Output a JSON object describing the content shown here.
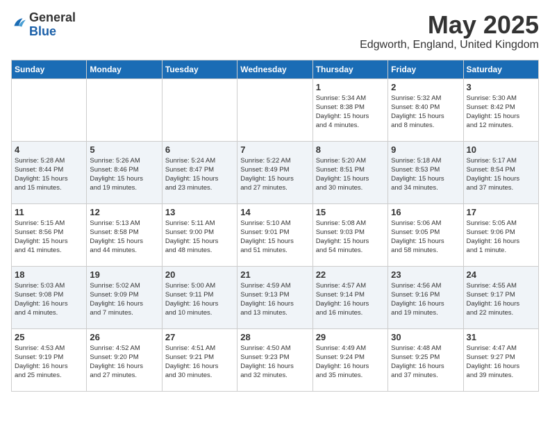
{
  "header": {
    "logo": {
      "general": "General",
      "blue": "Blue"
    },
    "title": "May 2025",
    "subtitle": "Edgworth, England, United Kingdom"
  },
  "days_of_week": [
    "Sunday",
    "Monday",
    "Tuesday",
    "Wednesday",
    "Thursday",
    "Friday",
    "Saturday"
  ],
  "weeks": [
    [
      {
        "day": "",
        "info": ""
      },
      {
        "day": "",
        "info": ""
      },
      {
        "day": "",
        "info": ""
      },
      {
        "day": "",
        "info": ""
      },
      {
        "day": "1",
        "info": "Sunrise: 5:34 AM\nSunset: 8:38 PM\nDaylight: 15 hours\nand 4 minutes."
      },
      {
        "day": "2",
        "info": "Sunrise: 5:32 AM\nSunset: 8:40 PM\nDaylight: 15 hours\nand 8 minutes."
      },
      {
        "day": "3",
        "info": "Sunrise: 5:30 AM\nSunset: 8:42 PM\nDaylight: 15 hours\nand 12 minutes."
      }
    ],
    [
      {
        "day": "4",
        "info": "Sunrise: 5:28 AM\nSunset: 8:44 PM\nDaylight: 15 hours\nand 15 minutes."
      },
      {
        "day": "5",
        "info": "Sunrise: 5:26 AM\nSunset: 8:46 PM\nDaylight: 15 hours\nand 19 minutes."
      },
      {
        "day": "6",
        "info": "Sunrise: 5:24 AM\nSunset: 8:47 PM\nDaylight: 15 hours\nand 23 minutes."
      },
      {
        "day": "7",
        "info": "Sunrise: 5:22 AM\nSunset: 8:49 PM\nDaylight: 15 hours\nand 27 minutes."
      },
      {
        "day": "8",
        "info": "Sunrise: 5:20 AM\nSunset: 8:51 PM\nDaylight: 15 hours\nand 30 minutes."
      },
      {
        "day": "9",
        "info": "Sunrise: 5:18 AM\nSunset: 8:53 PM\nDaylight: 15 hours\nand 34 minutes."
      },
      {
        "day": "10",
        "info": "Sunrise: 5:17 AM\nSunset: 8:54 PM\nDaylight: 15 hours\nand 37 minutes."
      }
    ],
    [
      {
        "day": "11",
        "info": "Sunrise: 5:15 AM\nSunset: 8:56 PM\nDaylight: 15 hours\nand 41 minutes."
      },
      {
        "day": "12",
        "info": "Sunrise: 5:13 AM\nSunset: 8:58 PM\nDaylight: 15 hours\nand 44 minutes."
      },
      {
        "day": "13",
        "info": "Sunrise: 5:11 AM\nSunset: 9:00 PM\nDaylight: 15 hours\nand 48 minutes."
      },
      {
        "day": "14",
        "info": "Sunrise: 5:10 AM\nSunset: 9:01 PM\nDaylight: 15 hours\nand 51 minutes."
      },
      {
        "day": "15",
        "info": "Sunrise: 5:08 AM\nSunset: 9:03 PM\nDaylight: 15 hours\nand 54 minutes."
      },
      {
        "day": "16",
        "info": "Sunrise: 5:06 AM\nSunset: 9:05 PM\nDaylight: 15 hours\nand 58 minutes."
      },
      {
        "day": "17",
        "info": "Sunrise: 5:05 AM\nSunset: 9:06 PM\nDaylight: 16 hours\nand 1 minute."
      }
    ],
    [
      {
        "day": "18",
        "info": "Sunrise: 5:03 AM\nSunset: 9:08 PM\nDaylight: 16 hours\nand 4 minutes."
      },
      {
        "day": "19",
        "info": "Sunrise: 5:02 AM\nSunset: 9:09 PM\nDaylight: 16 hours\nand 7 minutes."
      },
      {
        "day": "20",
        "info": "Sunrise: 5:00 AM\nSunset: 9:11 PM\nDaylight: 16 hours\nand 10 minutes."
      },
      {
        "day": "21",
        "info": "Sunrise: 4:59 AM\nSunset: 9:13 PM\nDaylight: 16 hours\nand 13 minutes."
      },
      {
        "day": "22",
        "info": "Sunrise: 4:57 AM\nSunset: 9:14 PM\nDaylight: 16 hours\nand 16 minutes."
      },
      {
        "day": "23",
        "info": "Sunrise: 4:56 AM\nSunset: 9:16 PM\nDaylight: 16 hours\nand 19 minutes."
      },
      {
        "day": "24",
        "info": "Sunrise: 4:55 AM\nSunset: 9:17 PM\nDaylight: 16 hours\nand 22 minutes."
      }
    ],
    [
      {
        "day": "25",
        "info": "Sunrise: 4:53 AM\nSunset: 9:19 PM\nDaylight: 16 hours\nand 25 minutes."
      },
      {
        "day": "26",
        "info": "Sunrise: 4:52 AM\nSunset: 9:20 PM\nDaylight: 16 hours\nand 27 minutes."
      },
      {
        "day": "27",
        "info": "Sunrise: 4:51 AM\nSunset: 9:21 PM\nDaylight: 16 hours\nand 30 minutes."
      },
      {
        "day": "28",
        "info": "Sunrise: 4:50 AM\nSunset: 9:23 PM\nDaylight: 16 hours\nand 32 minutes."
      },
      {
        "day": "29",
        "info": "Sunrise: 4:49 AM\nSunset: 9:24 PM\nDaylight: 16 hours\nand 35 minutes."
      },
      {
        "day": "30",
        "info": "Sunrise: 4:48 AM\nSunset: 9:25 PM\nDaylight: 16 hours\nand 37 minutes."
      },
      {
        "day": "31",
        "info": "Sunrise: 4:47 AM\nSunset: 9:27 PM\nDaylight: 16 hours\nand 39 minutes."
      }
    ]
  ]
}
